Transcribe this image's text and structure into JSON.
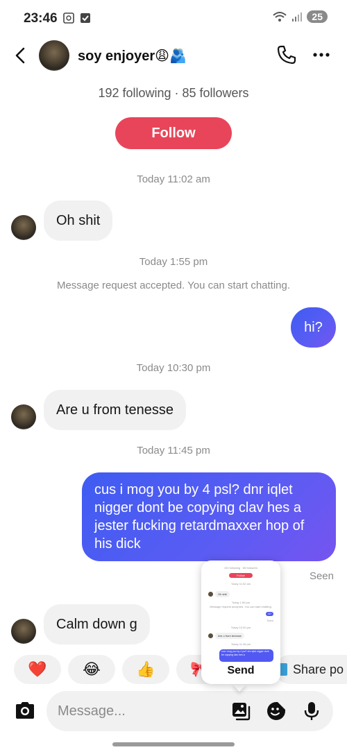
{
  "status_bar": {
    "time": "23:46",
    "battery": "25"
  },
  "header": {
    "name": "soy enjoyer😩🫂",
    "icons": [
      "back-icon",
      "phone-icon",
      "more-icon"
    ]
  },
  "profile": {
    "counts": "192 following · 85 followers",
    "follow_label": "Follow"
  },
  "conversation": {
    "timestamps": [
      "Today 11:02 am",
      "Today 1:55 pm",
      "Today 10:30 pm",
      "Today 11:45 pm"
    ],
    "system_message": "Message request accepted. You can start chatting.",
    "messages": [
      {
        "from": "them",
        "text": "Oh shit"
      },
      {
        "from": "me",
        "text": "hi?"
      },
      {
        "from": "them",
        "text": "Are u from tenesse"
      },
      {
        "from": "me",
        "text": "cus i mog you by 4 psl? dnr iqlet nigger dont be copying clav hes a jester fucking retardmaxxer hop of his dick"
      },
      {
        "from": "them",
        "text": "Calm down g"
      }
    ],
    "seen_label": "Seen"
  },
  "reactions": {
    "items": [
      "❤️",
      "😂",
      "👍",
      "🎀"
    ],
    "share_label": "Share po"
  },
  "popup": {
    "send_label": "Send",
    "mini": {
      "counts": "192 following · 85 followers",
      "follow": "Follow",
      "ts1": "Today 11:02 am",
      "msg1": "Oh shit",
      "ts2": "Today 1:55 pm",
      "sys": "Message request accepted. You can start chatting.",
      "out1": "hi?",
      "seen": "Seen",
      "ts3": "Today 10:30 pm",
      "msg2": "Are u from tenesse",
      "ts4": "Today 11:45 pm",
      "out2": "cus i mog you by 4 psl? dnr iqlet nigger dont be copying clav hes a"
    }
  },
  "composer": {
    "placeholder": "Message..."
  },
  "colors": {
    "accent": "#e8455a",
    "outgoing_start": "#3f5cf2",
    "outgoing_end": "#7654f0",
    "incoming": "#f1f1f1"
  }
}
